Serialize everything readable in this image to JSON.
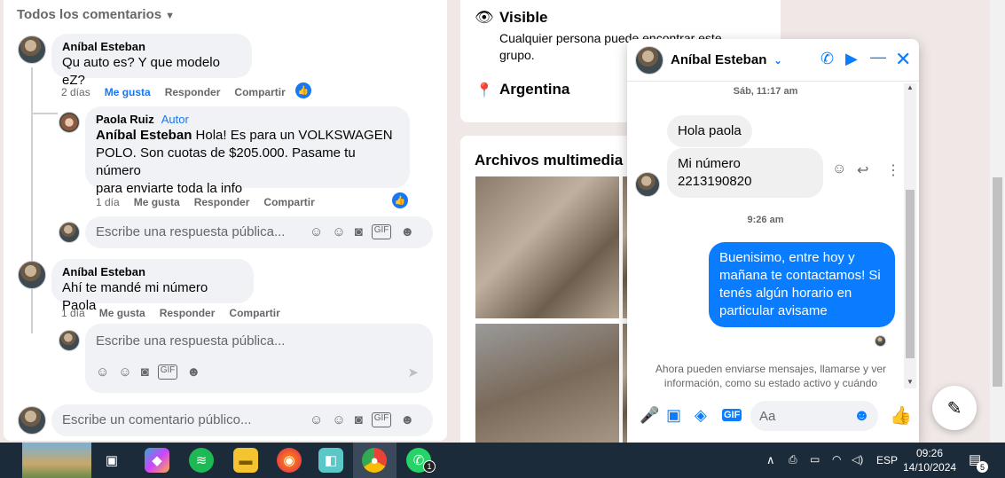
{
  "comments": {
    "header": "Todos los comentarios",
    "c1": {
      "name": "Aníbal Esteban",
      "text": "Qu auto es? Y que modelo eZ?",
      "time": "2 días",
      "like": "Me gusta",
      "reply": "Responder",
      "share": "Compartir"
    },
    "c2": {
      "name": "Paola Ruiz",
      "badge": "Autor",
      "mention": "Aníbal Esteban",
      "text": "Hola! Es para un VOLKSWAGEN",
      "text2": "POLO. Son cuotas de $205.000. Pasame tu número",
      "text3": "para enviarte toda la info",
      "time": "1 día",
      "like": "Me gusta",
      "reply": "Responder",
      "share": "Compartir"
    },
    "reply1_placeholder": "Escribe una respuesta pública...",
    "c3": {
      "name": "Aníbal Esteban",
      "text": "Ahí te mandé mi número Paola",
      "time": "1 día",
      "like": "Me gusta",
      "reply": "Responder",
      "share": "Compartir"
    },
    "reply2_placeholder": "Escribe una respuesta pública...",
    "main_placeholder": "Escribe un comentario público..."
  },
  "group_info": {
    "visible_title": "Visible",
    "visible_desc1": "Cualquier persona puede encontrar este",
    "visible_desc2": "grupo.",
    "location": "Argentina",
    "media_title": "Archivos multimedia re"
  },
  "chat": {
    "contact": "Aníbal Esteban",
    "ts1": "Sáb, 11:17 am",
    "m1": "Hola paola",
    "m2a": "Mi número",
    "m2b": "2213190820",
    "ts2": "9:26 am",
    "m3a": "Buenisimo, entre hoy y",
    "m3b": "mañana te contactamos! Si",
    "m3c": "tenés algún horario en",
    "m3d": "particular avisame",
    "notice1": "Ahora pueden enviarse mensajes, llamarse y ver",
    "notice2": "información, como su estado activo y cuándo",
    "input_placeholder": "Aa"
  },
  "taskbar": {
    "lang": "ESP",
    "time": "09:26",
    "date": "14/10/2024",
    "notif_count": "5",
    "whatsapp_badge": "1"
  },
  "colors": {
    "accent": "#1877f2",
    "messenger": "#0a7cff",
    "taskbar": "#1c2b3a"
  }
}
